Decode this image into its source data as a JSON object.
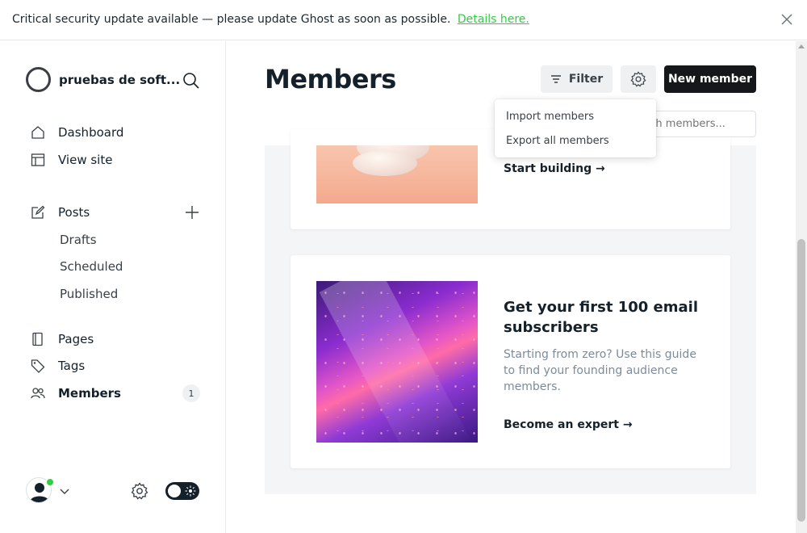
{
  "banner": {
    "text": "Critical security update available — please update Ghost as soon as possible.",
    "link": "Details here."
  },
  "sidebar": {
    "site_name": "pruebas de soft...",
    "nav": {
      "dashboard": "Dashboard",
      "view_site": "View site",
      "posts": "Posts",
      "drafts": "Drafts",
      "scheduled": "Scheduled",
      "published": "Published",
      "pages": "Pages",
      "tags": "Tags",
      "members": "Members",
      "members_count": "1"
    },
    "icons": [
      "home-icon",
      "layout-icon",
      "edit-icon",
      "plus-icon",
      "page-icon",
      "tag-icon",
      "members-icon",
      "gear-icon",
      "search-icon",
      "chevron-down-icon"
    ]
  },
  "header": {
    "title": "Members",
    "filter_label": "Filter",
    "new_member_label": "New member",
    "search_placeholder": "Search members..."
  },
  "dropdown": {
    "items": [
      "Import members",
      "Export all members"
    ]
  },
  "cards": [
    {
      "link": "Start building →"
    },
    {
      "title": "Get your first 100 email subscribers",
      "description": "Starting from zero? Use this guide to find your founding audience members.",
      "link": "Become an expert →"
    }
  ],
  "colors": {
    "accent_green": "#30cf43",
    "dark": "#15171a",
    "muted_text": "#7c8b9a",
    "panel_bg": "#f4f5f6"
  }
}
